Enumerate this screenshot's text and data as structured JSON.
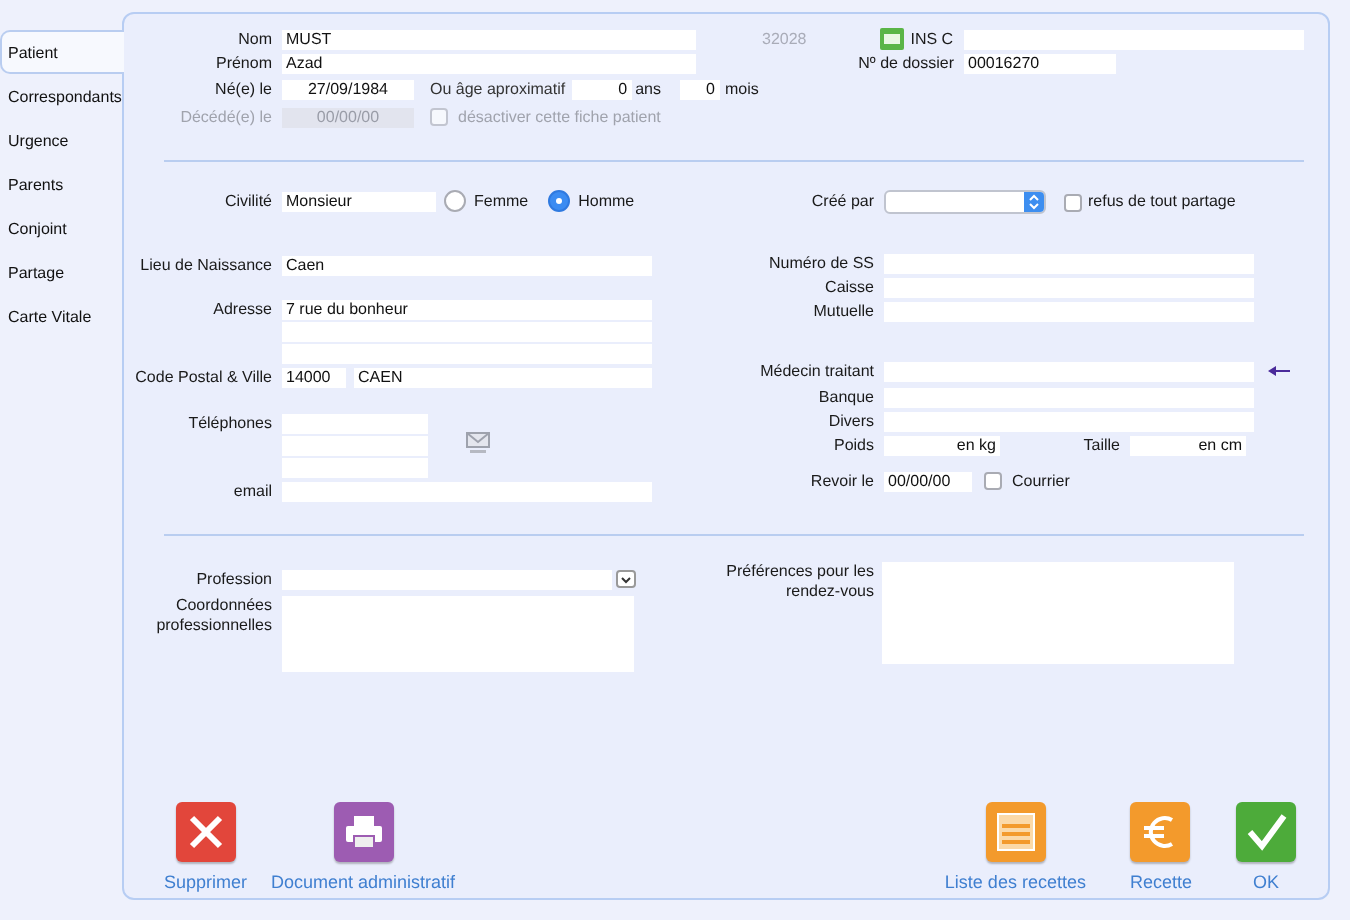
{
  "tabs": [
    {
      "label": "Patient",
      "selected": true
    },
    {
      "label": "Correspondants",
      "selected": false
    },
    {
      "label": "Urgence",
      "selected": false
    },
    {
      "label": "Parents",
      "selected": false
    },
    {
      "label": "Conjoint",
      "selected": false
    },
    {
      "label": "Partage",
      "selected": false
    },
    {
      "label": "Carte Vitale",
      "selected": false
    }
  ],
  "identity": {
    "last_name": {
      "label": "Nom",
      "value": "MUST"
    },
    "first_name": {
      "label": "Prénom",
      "value": "Azad"
    },
    "birth_date": {
      "label": "Né(e) le",
      "value": "27/09/1984"
    },
    "approx_age": {
      "label": "Ou âge aproximatif",
      "years": "0",
      "years_unit": "ans",
      "months": "0",
      "months_unit": "mois"
    },
    "death_date": {
      "label": "Décédé(e) le",
      "value": "00/00/00",
      "disabled": true
    },
    "deactivate": {
      "label": "désactiver cette fiche patient",
      "checked": false,
      "disabled": true
    },
    "patient_number": "32028",
    "ins": {
      "label": "INS C"
    },
    "file_number": {
      "label": "Nº de dossier",
      "value": "00016270"
    }
  },
  "civility": {
    "label": "Civilité",
    "value": "Monsieur",
    "options": [
      {
        "label": "Femme",
        "selected": false
      },
      {
        "label": "Homme",
        "selected": true
      }
    ]
  },
  "created_by": {
    "label": "Créé par"
  },
  "refuse_sharing": {
    "label": "refus de tout partage",
    "checked": false
  },
  "birthplace": {
    "label": "Lieu de Naissance",
    "value": "Caen"
  },
  "address": {
    "label": "Adresse",
    "lines": [
      "7 rue du bonheur"
    ]
  },
  "postal_city": {
    "label": "Code Postal & Ville",
    "postal_code": "14000",
    "city": "CAEN"
  },
  "phones": {
    "label": "Téléphones"
  },
  "email": {
    "label": "email"
  },
  "social_security": {
    "label": "Numéro de SS"
  },
  "fund": {
    "label": "Caisse"
  },
  "mutual": {
    "label": "Mutuelle"
  },
  "doctor": {
    "label": "Médecin traitant"
  },
  "bank": {
    "label": "Banque"
  },
  "misc": {
    "label": "Divers"
  },
  "weight": {
    "label": "Poids",
    "unit": "en kg"
  },
  "height": {
    "label": "Taille",
    "unit": "en cm"
  },
  "revisit": {
    "label": "Revoir le",
    "value": "00/00/00"
  },
  "mail": {
    "label": "Courrier",
    "checked": false
  },
  "profession": {
    "label": "Profession"
  },
  "work_contact": {
    "label": "Coordonnées professionnelles"
  },
  "appointment_prefs": {
    "label": "Préférences pour les rendez-vous"
  },
  "buttons": [
    {
      "label": "Supprimer",
      "kind": "delete"
    },
    {
      "label": "Document administratif",
      "kind": "print"
    },
    {
      "label": "Liste des recettes",
      "kind": "list"
    },
    {
      "label": "Recette",
      "kind": "euro"
    },
    {
      "label": "OK",
      "kind": "ok"
    }
  ]
}
